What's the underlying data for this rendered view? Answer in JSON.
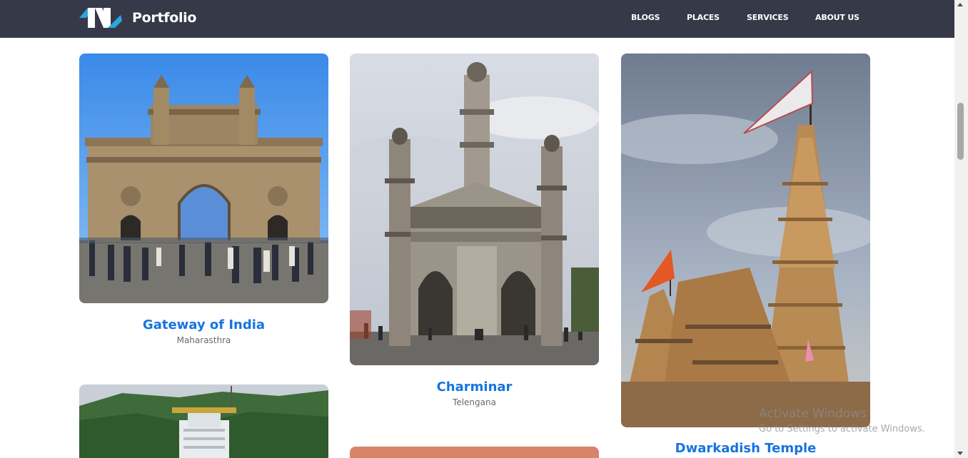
{
  "nav": {
    "brand": "Portfolio",
    "links": [
      "BLOGS",
      "PLACES",
      "SERVICES",
      "ABOUT US"
    ]
  },
  "cards": [
    {
      "title": "Gateway of India",
      "subtitle": "Maharasthra"
    },
    {
      "title": "Charminar",
      "subtitle": "Telengana"
    },
    {
      "title": "Dwarkadish Temple",
      "subtitle": ""
    },
    {
      "title": "",
      "subtitle": ""
    },
    {
      "title": "",
      "subtitle": ""
    }
  ],
  "watermark": {
    "title": "Activate Windows",
    "subtitle": "Go to Settings to activate Windows."
  },
  "colors": {
    "navbar": "#363a48",
    "accent": "#1574e0",
    "subtitle": "#6b6b6b"
  }
}
